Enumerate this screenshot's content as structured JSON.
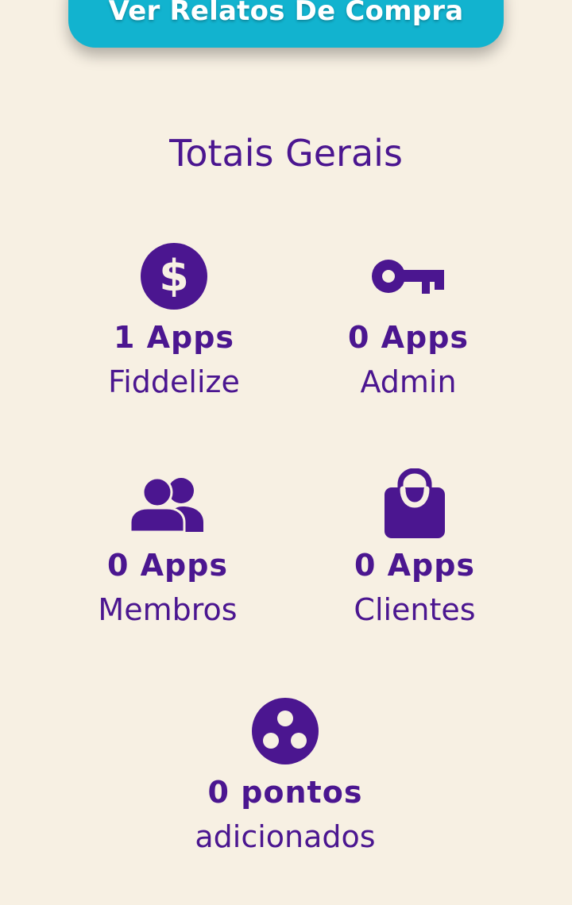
{
  "top_button": {
    "label": "Ver Relatos De Compra"
  },
  "section": {
    "title": "Totais Gerais"
  },
  "stats": {
    "fiddelize": {
      "count": "1 Apps",
      "label": "Fiddelize",
      "icon": "dollar-coin-icon"
    },
    "admin": {
      "count": "0 Apps",
      "label": "Admin",
      "icon": "key-icon"
    },
    "membros": {
      "count": "0 Apps",
      "label": "Membros",
      "icon": "users-icon"
    },
    "clientes": {
      "count": "0 Apps",
      "label": "Clientes",
      "icon": "shopping-bag-icon"
    },
    "pontos": {
      "count": "0 pontos",
      "label": "adicionados",
      "icon": "points-circle-icon"
    }
  },
  "colors": {
    "background": "#f7f0e3",
    "primary": "#4b1690",
    "button": "#12b3cf"
  }
}
